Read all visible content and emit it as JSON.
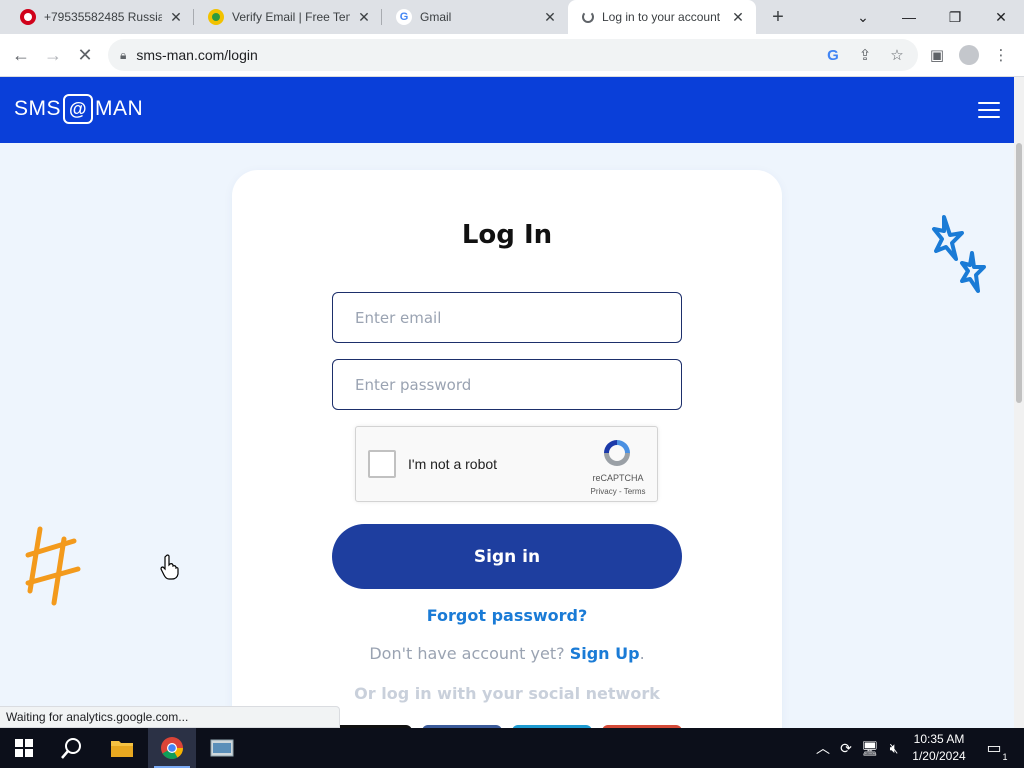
{
  "browser": {
    "tabs": [
      {
        "title": "+79535582485 Russia",
        "favicon": "opera-red-circle-icon"
      },
      {
        "title": "Verify Email | Free Tem",
        "favicon": "yellow-green-circle-icon"
      },
      {
        "title": "Gmail",
        "favicon": "google-g-icon"
      },
      {
        "title": "Log in to your account",
        "favicon": "loading-spinner-icon"
      }
    ],
    "address": "sms-man.com/login",
    "status": "Waiting for analytics.google.com..."
  },
  "site": {
    "logo_left": "SMS",
    "logo_right": "MAN"
  },
  "login": {
    "title": "Log In",
    "email_placeholder": "Enter email",
    "password_placeholder": "Enter password",
    "email_value": "",
    "password_value": "",
    "recaptcha_label": "I'm not a robot",
    "recaptcha_brand": "reCAPTCHA",
    "recaptcha_privacy": "Privacy",
    "recaptcha_terms": "Terms",
    "signin_label": "Sign in",
    "forgot_label": "Forgot password?",
    "no_account_text": "Don't have account yet?",
    "signup_label": "Sign Up",
    "social_title": "Or log in with your social network"
  },
  "colors": {
    "header_blue": "#0a3fd9",
    "signin_blue": "#1e3e9f",
    "link_blue": "#1a7bd6"
  },
  "taskbar": {
    "time": "10:35 AM",
    "date": "1/20/2024",
    "notification_count": "1"
  }
}
